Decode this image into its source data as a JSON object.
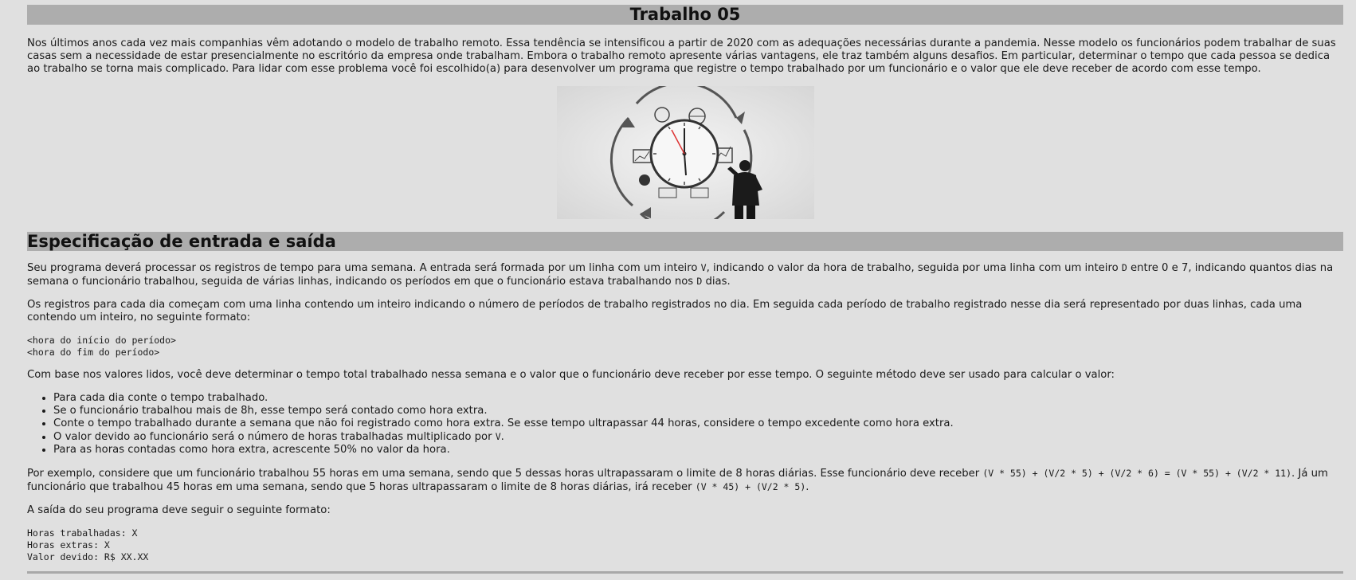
{
  "title": "Trabalho 05",
  "intro": "Nos últimos anos cada vez mais companhias vêm adotando o modelo de trabalho remoto. Essa tendência se intensificou a partir de 2020 com as adequações necessárias durante a pandemia. Nesse modelo os funcionários podem trabalhar de suas casas sem a necessidade de estar presencialmente no escritório da empresa onde trabalham. Embora o trabalho remoto apresente várias vantagens, ele traz também alguns desafios. Em particular, determinar o tempo que cada pessoa se dedica ao trabalho se torna mais complicado. Para lidar com esse problema você foi escolhido(a) para desenvolver um programa que registre o tempo trabalhado por um funcionário e o valor que ele deve receber de acordo com esse tempo.",
  "figure": {
    "icon": "clock-businessman-illustration"
  },
  "section_title": "Especificação de entrada e saída",
  "p1": {
    "a": "Seu programa deverá processar os registros de tempo para uma semana. A entrada será formada por um linha com um inteiro ",
    "v": "V",
    "b": ", indicando o valor da hora de trabalho, seguida por uma linha com um inteiro ",
    "d": "D",
    "c": " entre 0 e 7, indicando quantos dias na semana o funcionário trabalhou, seguida de várias linhas, indicando os períodos em que o funcionário estava trabalhando nos ",
    "d2": "D",
    "e": " dias."
  },
  "p2": "Os registros para cada dia começam com uma linha contendo um inteiro indicando o número de períodos de trabalho registrados no dia. Em seguida cada período de trabalho registrado nesse dia será representado por duas linhas, cada uma contendo um inteiro, no seguinte formato:",
  "code1": [
    "<hora do início do período>",
    "<hora do fim do período>"
  ],
  "p3": "Com base nos valores lidos, você deve determinar o tempo total trabalhado nessa semana e o valor que o funcionário deve receber por esse tempo. O seguinte método deve ser usado para calcular o valor:",
  "bullets": [
    "Para cada dia conte o tempo trabalhado.",
    "Se o funcionário trabalhou mais de 8h, esse tempo será contado como hora extra.",
    "Conte o tempo trabalhado durante a semana que não foi registrado como hora extra. Se esse tempo ultrapassar 44 horas, considere o tempo excedente como hora extra.",
    {
      "a": "O valor devido ao funcionário será o número de horas trabalhadas multiplicado por ",
      "code": "V",
      "b": "."
    },
    "Para as horas contadas como hora extra, acrescente 50% no valor da hora."
  ],
  "p4": {
    "a": "Por exemplo, considere que um funcionário trabalhou 55 horas em uma semana, sendo que 5 dessas horas ultrapassaram o limite de 8 horas diárias. Esse funcionário deve receber ",
    "code1": "(V * 55) + (V/2 * 5) + (V/2 * 6) = (V * 55) + (V/2 * 11)",
    "b": ". Já um funcionário que trabalhou 45 horas em uma semana, sendo que 5 horas ultrapassaram o limite de 8 horas diárias, irá receber ",
    "code2": "(V * 45) + (V/2 * 5)",
    "c": "."
  },
  "p5": "A saída do seu programa deve seguir o seguinte formato:",
  "code2": [
    "Horas trabalhadas: X",
    "Horas extras: X",
    "Valor devido: R$ XX.XX"
  ]
}
